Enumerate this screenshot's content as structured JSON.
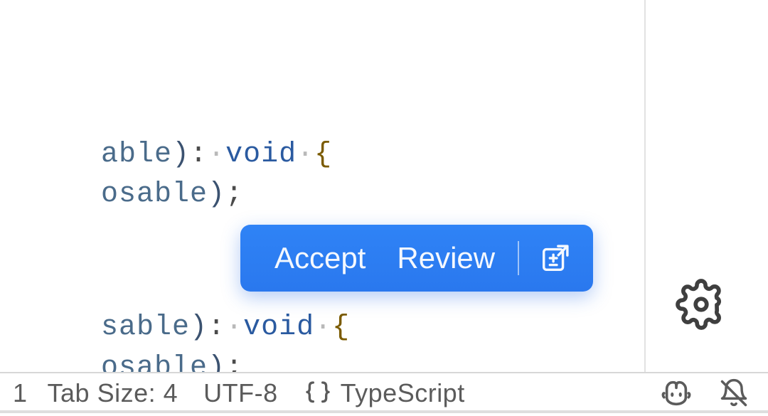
{
  "code": {
    "line1": {
      "ident": "able",
      "close": ")",
      "colon": ":",
      "ws1": "·",
      "keyword": "void",
      "ws2": "·",
      "brace": "{"
    },
    "line2": {
      "ident": "osable",
      "close": ")",
      "semi": ";"
    },
    "line3": {
      "ident": "sable",
      "close": ")",
      "colon": ":",
      "ws1": "·",
      "keyword": "void",
      "ws2": "·",
      "brace": "{"
    },
    "line4": {
      "ident": "osable",
      "close": ")",
      "semi": ";"
    }
  },
  "toolbar": {
    "accept_label": "Accept",
    "review_label": "Review"
  },
  "status": {
    "col": "1",
    "tab_size": "Tab Size: 4",
    "encoding": "UTF-8",
    "language": "TypeScript"
  }
}
